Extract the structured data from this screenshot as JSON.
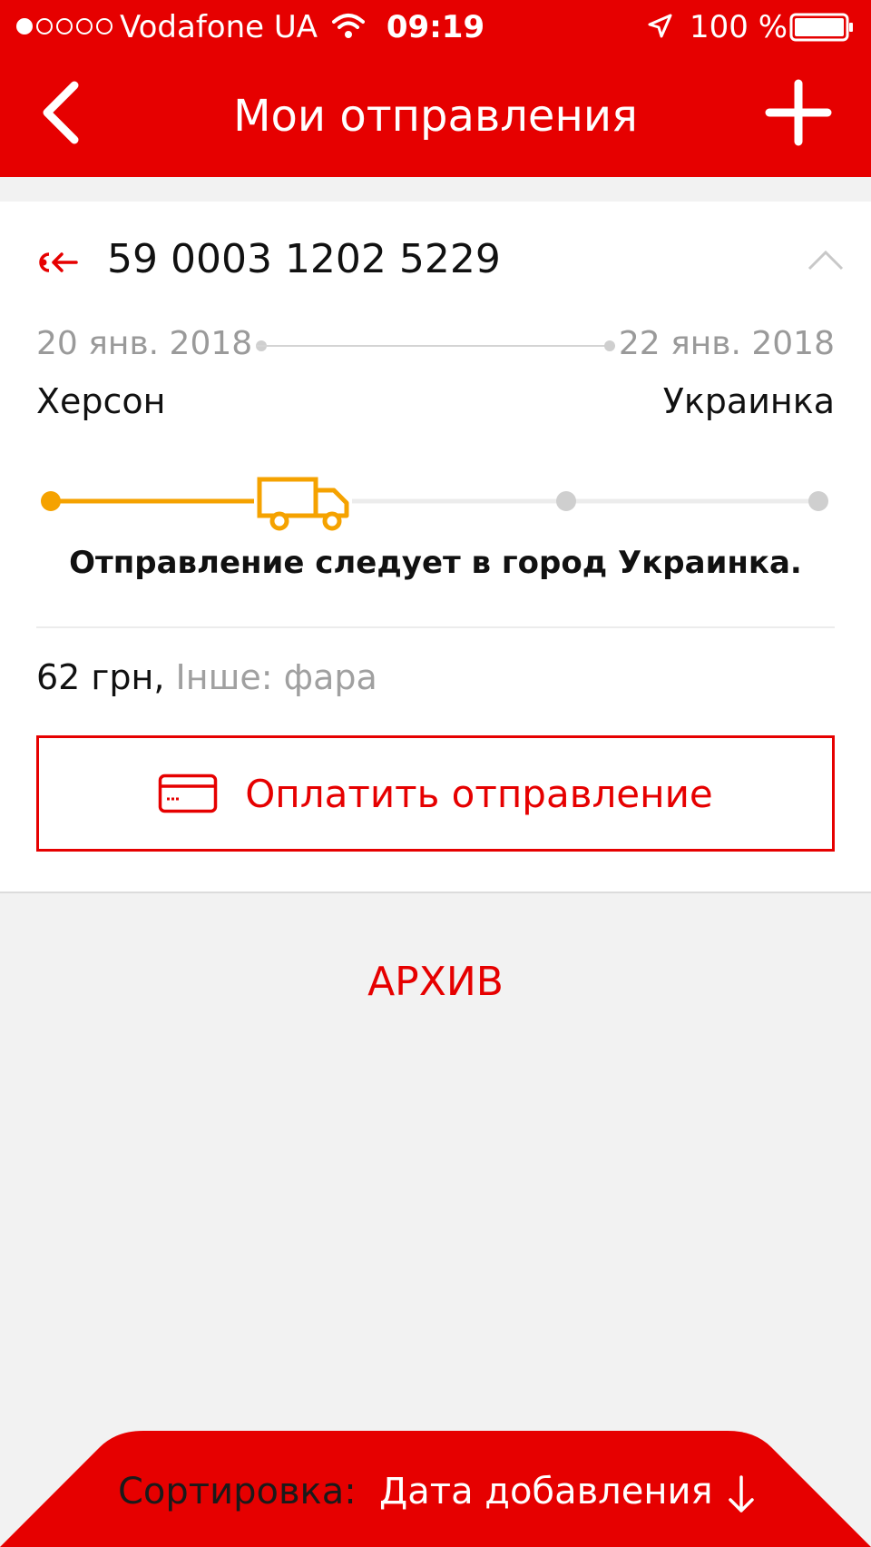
{
  "status_bar": {
    "carrier": "Vodafone UA",
    "time": "09:19",
    "battery": "100 %"
  },
  "nav": {
    "title": "Мои отправления",
    "back_icon": "chevron-left-icon",
    "add_icon": "plus-icon"
  },
  "shipment": {
    "direction_icon": "incoming-parcel-icon",
    "tracking_number": "59 0003 1202 5229",
    "date_from": "20 янв. 2018",
    "date_to": "22 янв. 2018",
    "city_from": "Херсон",
    "city_to": "Украинка",
    "progress_stage": 2,
    "progress_stages_total": 4,
    "status_text": "Отправление следует в город Украинка.",
    "price": "62 грн,",
    "description": "Інше: фара",
    "pay_button_label": "Оплатить отправление"
  },
  "archive_label": "АРХИВ",
  "sort": {
    "label": "Сортировка:",
    "value": "Дата добавления"
  },
  "colors": {
    "brand_red": "#e60000",
    "progress_orange": "#f5a200",
    "inactive_gray": "#cfcfcf"
  }
}
